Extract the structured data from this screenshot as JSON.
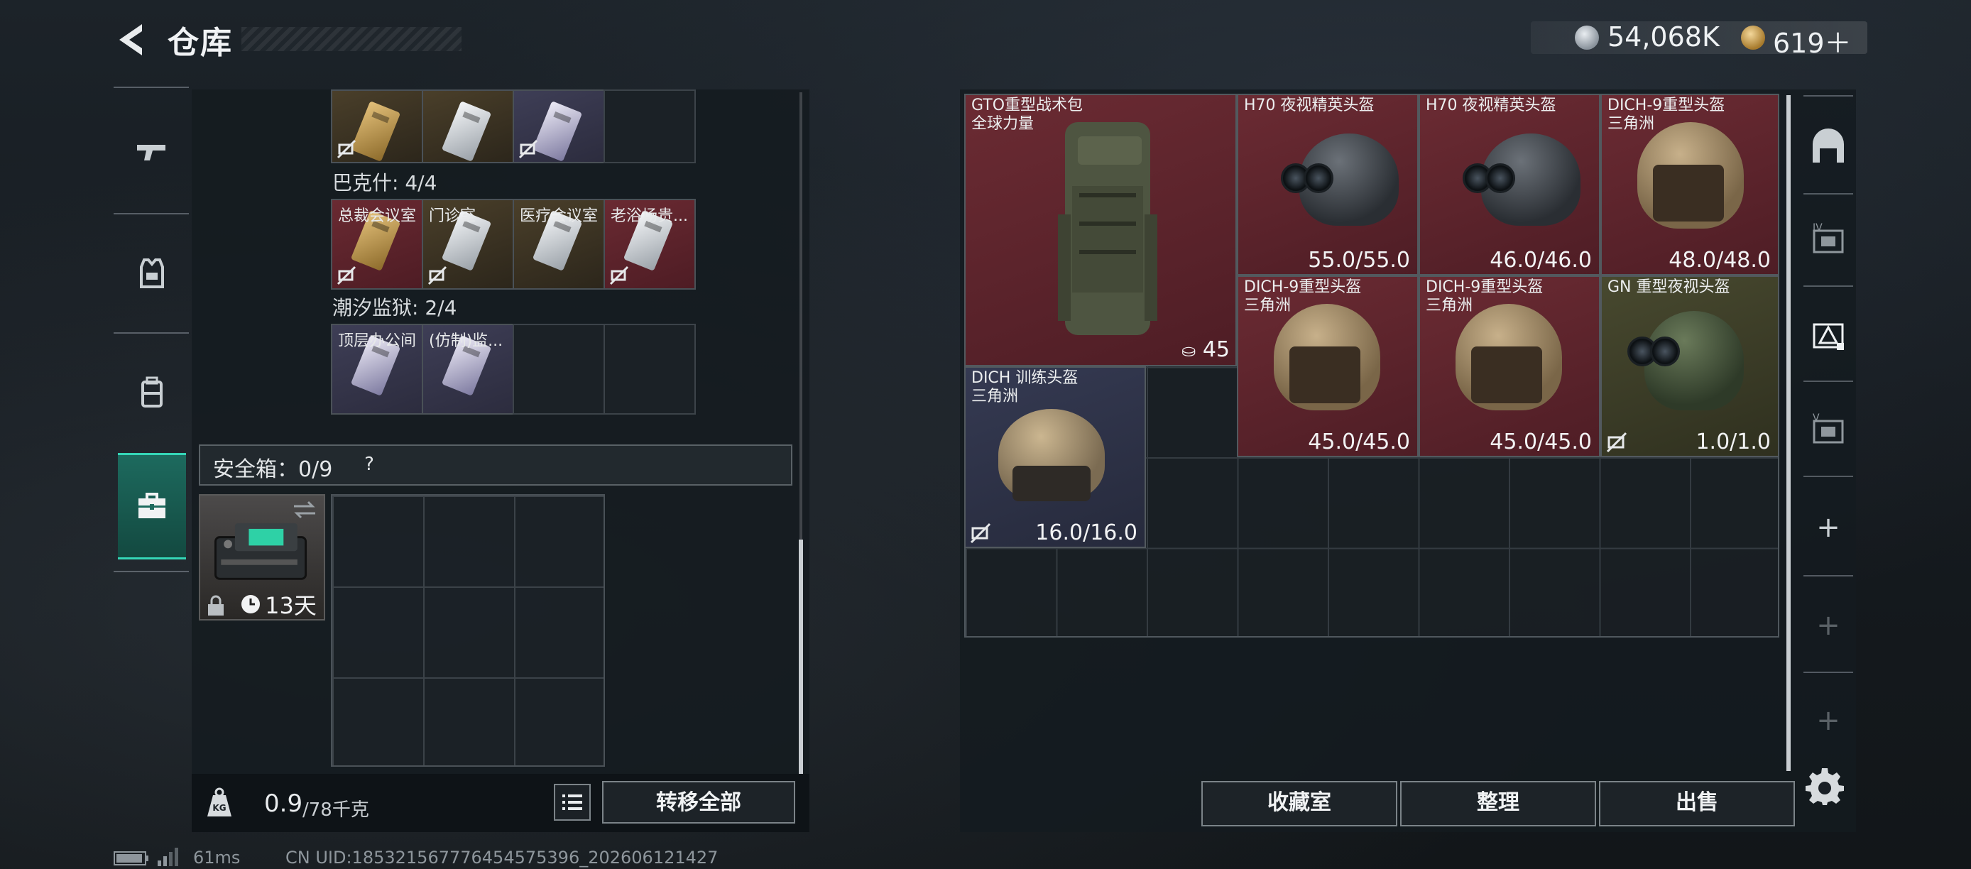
{
  "header": {
    "title": "仓库",
    "currency": {
      "silver": "54,068K",
      "gold": "619"
    }
  },
  "left_tabs": [
    {
      "name": "weapons",
      "icon": "pistol-icon",
      "active": false
    },
    {
      "name": "gear",
      "icon": "armor-vest-icon",
      "active": false
    },
    {
      "name": "backpack",
      "icon": "backpack-icon",
      "active": false
    },
    {
      "name": "keys",
      "icon": "toolbox-icon",
      "active": true
    }
  ],
  "key_groups": {
    "top_cells": [
      {
        "name": "",
        "color": "gold",
        "card": "gold",
        "unlinked": true
      },
      {
        "name": "",
        "color": "gold",
        "card": "white",
        "unlinked": false
      },
      {
        "name": "",
        "color": "purple",
        "card": "violet",
        "unlinked": true
      },
      {
        "name": "",
        "color": "empty",
        "card": "",
        "unlinked": false
      }
    ],
    "group1": {
      "label": "巴克什: 4/4",
      "cells": [
        {
          "name": "总裁会议室",
          "color": "red",
          "card": "gold",
          "unlinked": true
        },
        {
          "name": "门诊室",
          "color": "gold",
          "card": "white",
          "unlinked": true
        },
        {
          "name": "医疗会议室",
          "color": "gold",
          "card": "white",
          "unlinked": false
        },
        {
          "name": "老浴场贵...",
          "color": "red",
          "card": "white",
          "unlinked": true
        }
      ]
    },
    "group2": {
      "label": "潮汐监狱: 2/4",
      "cells": [
        {
          "name": "顶层办公间",
          "color": "purple",
          "card": "violet",
          "unlinked": false
        },
        {
          "name": "(仿制)监...",
          "color": "purple",
          "card": "violet",
          "unlinked": false
        },
        {
          "name": "",
          "color": "empty",
          "card": "",
          "unlinked": false
        },
        {
          "name": "",
          "color": "empty",
          "card": "",
          "unlinked": false
        }
      ]
    }
  },
  "safebox": {
    "label": "安全箱：0/9",
    "help": "?",
    "days_left": "13天"
  },
  "bottom": {
    "weight_icon_text": "KG",
    "weight_current": "0.9",
    "weight_total": "/78千克",
    "transfer_all": "转移全部"
  },
  "stash_items": [
    {
      "name": "GTO重型战术包\n全球力量",
      "type": "backpack",
      "qty": "45",
      "color": "red"
    },
    {
      "name": "H70 夜视精英头盔",
      "type": "helmet-nvg-dark",
      "durability": "55.0/55.0",
      "color": "red"
    },
    {
      "name": "H70 夜视精英头盔",
      "type": "helmet-nvg-dark",
      "durability": "46.0/46.0",
      "color": "red"
    },
    {
      "name": "DICH-9重型头盔\n三角洲",
      "type": "helmet-tan",
      "durability": "48.0/48.0",
      "color": "red"
    },
    {
      "name": "DICH-9重型头盔\n三角洲",
      "type": "helmet-tan",
      "durability": "45.0/45.0",
      "color": "red"
    },
    {
      "name": "DICH-9重型头盔\n三角洲",
      "type": "helmet-tan",
      "durability": "45.0/45.0",
      "color": "red"
    },
    {
      "name": "GN 重型夜视头盔",
      "type": "helmet-nvg-green",
      "durability": "1.0/1.0",
      "color": "olive"
    },
    {
      "name": "DICH 训练头盔\n三角洲",
      "type": "helmet-camo",
      "durability": "16.0/16.0",
      "color": "purple"
    }
  ],
  "stash_buttons": {
    "collection": "收藏室",
    "sort": "整理",
    "sell": "出售"
  },
  "right_tabs": [
    {
      "name": "stash-main",
      "icon": "house-icon"
    },
    {
      "name": "stash-iv",
      "icon": "stash-iv-icon",
      "label": "IV"
    },
    {
      "name": "stash-delta",
      "icon": "stash-delta-icon"
    },
    {
      "name": "stash-v",
      "icon": "stash-v-icon",
      "label": "V"
    },
    {
      "name": "add-1",
      "icon": "plus-icon",
      "label": "+"
    },
    {
      "name": "add-2",
      "icon": "plus-icon",
      "label": "+"
    },
    {
      "name": "add-3",
      "icon": "plus-icon",
      "label": "+"
    }
  ],
  "footer": {
    "ping": "61ms",
    "uid": "CN UID:1853215677764545753​96_202606121427"
  },
  "colors": {
    "accent": "#35d6b7",
    "rare_red": "#6b2b33",
    "rare_purple": "#353a52",
    "rare_gold": "#4a3f2a"
  }
}
